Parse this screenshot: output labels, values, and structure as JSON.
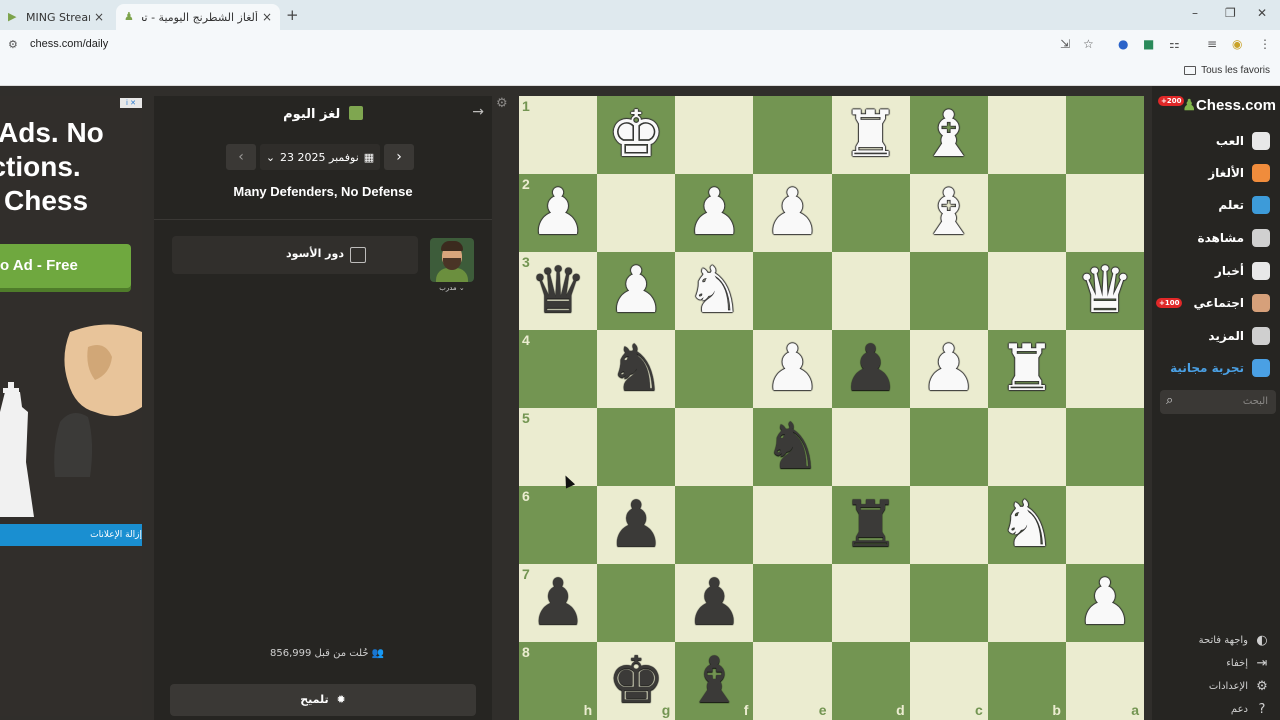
{
  "browser": {
    "tabs": [
      {
        "label": "MING Stream - Watch L",
        "active": false
      },
      {
        "label": "ألغاز الشطرنج اليومية - تحدي الك",
        "active": true
      }
    ],
    "new_tab": "+",
    "url": "chess.com/daily",
    "favorites_folder": "Tous les favoris",
    "window_controls": {
      "minimize": "–",
      "restore": "❐",
      "close": "✕"
    }
  },
  "ad": {
    "headline": [
      "Ads. No",
      "ractions.",
      " Chess"
    ],
    "button": "o Ad - Free",
    "remove_ads": "إزالة الإعلانات"
  },
  "puzzle_panel": {
    "title": "لغز اليوم",
    "date": "23 نوفمبر 2025",
    "prev_arrow": "‹",
    "next_arrow": "›",
    "puzzle_name": "Many Defenders, No Defense",
    "turn_label": "دور الأسود",
    "coach_label": "مدرب",
    "solved_count": "حُلت من قبل 856,999",
    "hint_button": "تلميح"
  },
  "board": {
    "orientation": "black",
    "ranks": [
      "1",
      "2",
      "3",
      "4",
      "5",
      "6",
      "7",
      "8"
    ],
    "files": [
      "h",
      "g",
      "f",
      "e",
      "d",
      "c",
      "b",
      "a"
    ],
    "pieces": [
      {
        "square": "g1",
        "color": "w",
        "glyph": "♚"
      },
      {
        "square": "d1",
        "color": "w",
        "glyph": "♜"
      },
      {
        "square": "c1",
        "color": "w",
        "glyph": "♝"
      },
      {
        "square": "h2",
        "color": "w",
        "glyph": "♟"
      },
      {
        "square": "f2",
        "color": "w",
        "glyph": "♟"
      },
      {
        "square": "e2",
        "color": "w",
        "glyph": "♟"
      },
      {
        "square": "c2",
        "color": "w",
        "glyph": "♝"
      },
      {
        "square": "h3",
        "color": "b",
        "glyph": "♛"
      },
      {
        "square": "g3",
        "color": "w",
        "glyph": "♟"
      },
      {
        "square": "f3",
        "color": "w",
        "glyph": "♞"
      },
      {
        "square": "a3",
        "color": "w",
        "glyph": "♛"
      },
      {
        "square": "g4",
        "color": "b",
        "glyph": "♞"
      },
      {
        "square": "e4",
        "color": "w",
        "glyph": "♟"
      },
      {
        "square": "d4",
        "color": "b",
        "glyph": "♟"
      },
      {
        "square": "c4",
        "color": "w",
        "glyph": "♟"
      },
      {
        "square": "b4",
        "color": "w",
        "glyph": "♜"
      },
      {
        "square": "e5",
        "color": "b",
        "glyph": "♞"
      },
      {
        "square": "g6",
        "color": "b",
        "glyph": "♟"
      },
      {
        "square": "d6",
        "color": "b",
        "glyph": "♜"
      },
      {
        "square": "b6",
        "color": "w",
        "glyph": "♞"
      },
      {
        "square": "h7",
        "color": "b",
        "glyph": "♟"
      },
      {
        "square": "f7",
        "color": "b",
        "glyph": "♟"
      },
      {
        "square": "a7",
        "color": "w",
        "glyph": "♟"
      },
      {
        "square": "g8",
        "color": "b",
        "glyph": "♚"
      },
      {
        "square": "f8",
        "color": "b",
        "glyph": "♝"
      }
    ],
    "colors": {
      "light": "#ebecd0",
      "dark": "#739552"
    }
  },
  "right_nav": {
    "logo": "Chess.com",
    "badge_top": "+200",
    "badge_social": "+100",
    "items": [
      {
        "label": "العب",
        "icon": "play-icon",
        "color": "#e8e8e8"
      },
      {
        "label": "الألغاز",
        "icon": "puzzle-icon",
        "color": "#f08c3c"
      },
      {
        "label": "تعلم",
        "icon": "learn-icon",
        "color": "#3d9bd9"
      },
      {
        "label": "مشاهدة",
        "icon": "watch-icon",
        "color": "#d0d0d0"
      },
      {
        "label": "أخبار",
        "icon": "news-icon",
        "color": "#e8e8e8"
      },
      {
        "label": "اجتماعي",
        "icon": "social-icon",
        "color": "#d6a07a"
      },
      {
        "label": "المزيد",
        "icon": "more-icon",
        "color": "#cfcfcf"
      },
      {
        "label": "تجربة مجانية",
        "icon": "diamond-icon",
        "color": "#4aa0e4"
      }
    ],
    "search_placeholder": "البحث",
    "bottom_items": [
      {
        "label": "واجهة فاتحة",
        "icon": "◐"
      },
      {
        "label": "إخفاء",
        "icon": "⇥"
      },
      {
        "label": "الإعدادات",
        "icon": "⚙"
      },
      {
        "label": "دعم",
        "icon": "?"
      }
    ]
  }
}
